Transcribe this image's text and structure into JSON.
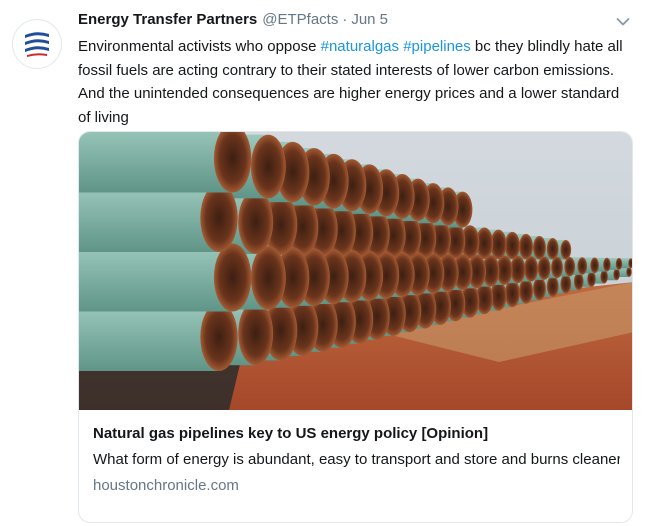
{
  "tweet": {
    "author_name": "Energy Transfer Partners",
    "handle": "@ETPfacts",
    "separator": "·",
    "date": "Jun 5",
    "text_before": "Environmental activists who oppose ",
    "hashtags": [
      "#naturalgas",
      "#pipelines"
    ],
    "text_after": " bc they blindly hate all fossil fuels are acting contrary to their stated interests of lower carbon emissions. And the unintended consequences are higher energy prices and a lower standard of living",
    "avatar_icon": "energy-transfer-logo-icon",
    "menu_icon": "chevron-down-icon"
  },
  "card": {
    "image_icon": "pipeline-stacks-photo",
    "title": "Natural gas pipelines key to US energy policy [Opinion]",
    "description": "What form of energy is abundant, easy to transport and store and burns cleaner than oil or coal? Flummoxed? It's natural gas. But because it's not a",
    "domain": "houstonchronicle.com"
  },
  "colors": {
    "link": "#1b95e0",
    "secondary_text": "#657786",
    "logo_blue": "#1f4e9c",
    "pipe_green": "#7fb7a9",
    "pipe_rust": "#8b4a2a",
    "dirt": "#b8532e",
    "sky": "#c8d0d6"
  }
}
